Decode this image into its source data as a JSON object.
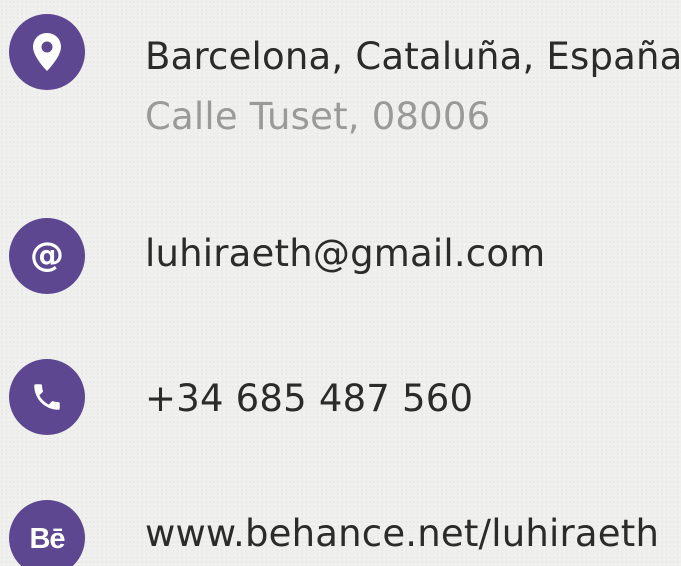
{
  "theme": {
    "accent": "#5d4791",
    "primary_text": "#2b2b2b",
    "secondary_text": "#9a9a9a",
    "background": "#efefed"
  },
  "contacts": [
    {
      "icon": "location-pin-icon",
      "primary": "Barcelona, Cataluña, España",
      "secondary": "Calle Tuset, 08006"
    },
    {
      "icon": "at-sign-icon",
      "icon_glyph": "@",
      "primary": "luhiraeth@gmail.com"
    },
    {
      "icon": "phone-icon",
      "primary": "+34 685 487 560"
    },
    {
      "icon": "behance-icon",
      "icon_glyph": "Bē",
      "primary": "www.behance.net/luhiraeth"
    }
  ]
}
